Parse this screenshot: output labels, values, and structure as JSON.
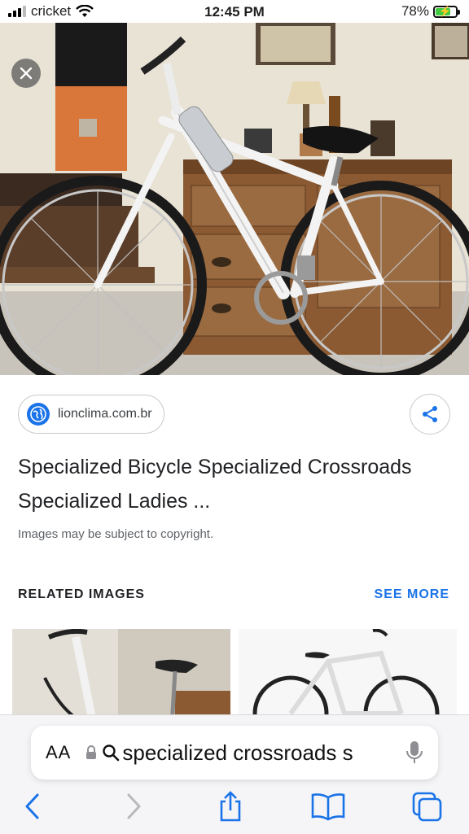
{
  "status_bar": {
    "carrier": "cricket",
    "time": "12:45 PM",
    "battery": "78%",
    "battery_level": 0.78
  },
  "viewer": {
    "close_icon": "close-icon",
    "source": {
      "icon": "globe-icon",
      "domain": "lionclima.com.br"
    },
    "share_icon": "share-icon",
    "title": "Specialized Bicycle Specialized Crossroads Specialized Ladies ...",
    "copyright_note": "Images may be subject to copyright."
  },
  "related": {
    "heading": "RELATED IMAGES",
    "see_more": "SEE MORE"
  },
  "address_bar": {
    "aa_label": "AA",
    "query": "specialized crossroads s",
    "lock_icon": "lock-icon",
    "search_icon": "search-icon",
    "mic_icon": "microphone-icon"
  },
  "toolbar": {
    "icons": [
      "back-chevron-icon",
      "forward-chevron-icon",
      "share-icon",
      "bookmarks-icon",
      "tabs-icon"
    ]
  },
  "colors": {
    "accent": "#1a73e8",
    "battery": "#3fca3f"
  }
}
